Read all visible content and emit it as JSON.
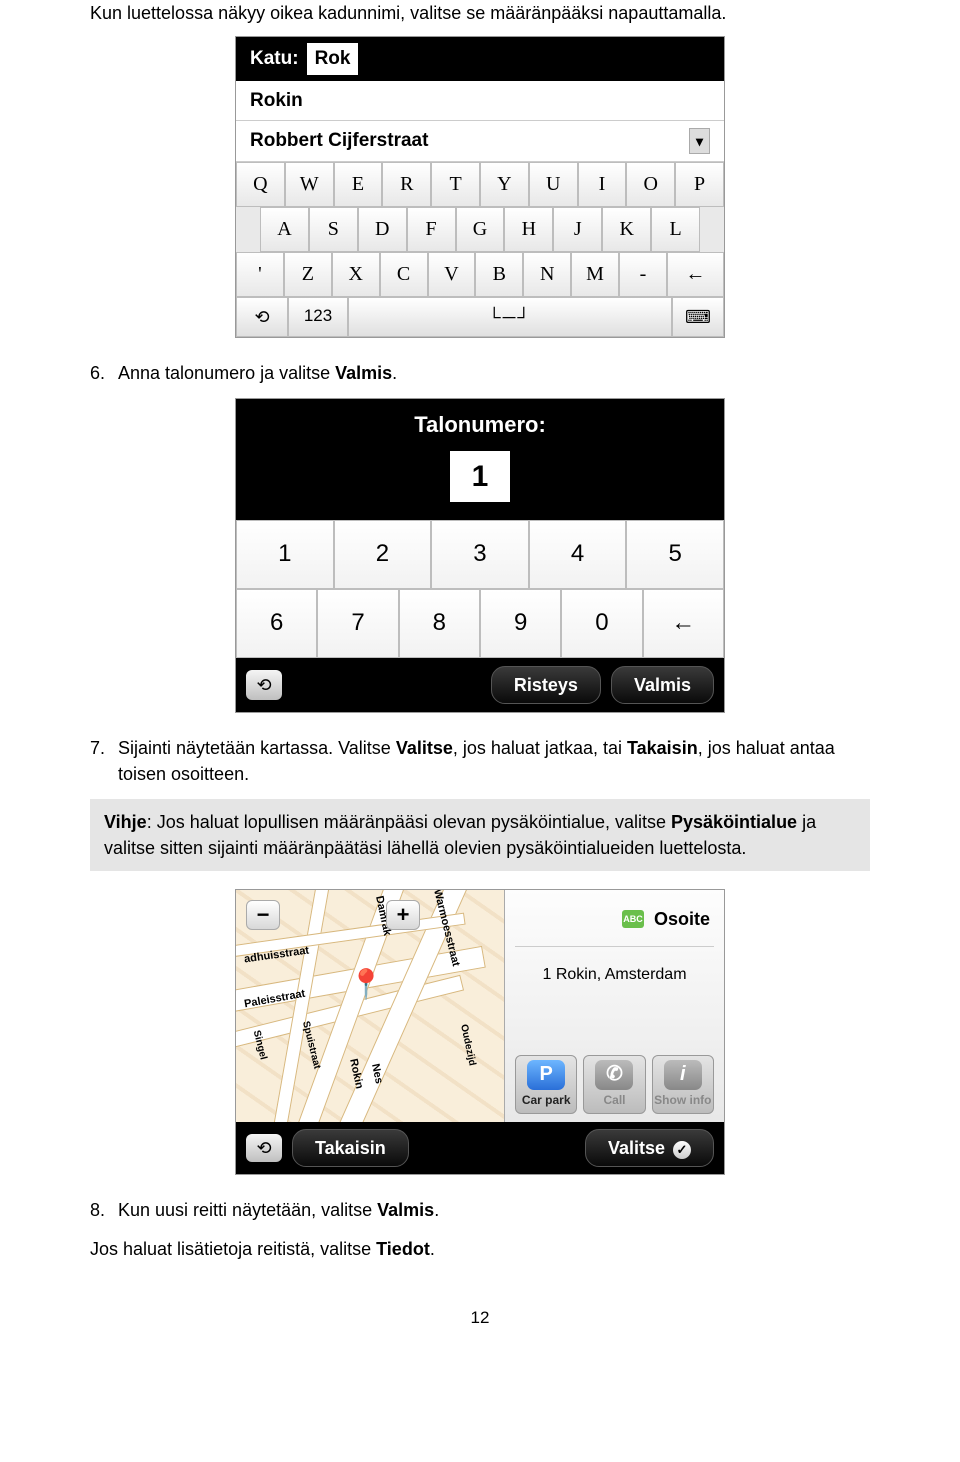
{
  "intro_para": "Kun luettelossa näkyy oikea kadunnimi, valitse se määränpääksi napauttamalla.",
  "shot1": {
    "field_label": "Katu:",
    "field_value": "Rok",
    "suggestions": [
      "Rokin",
      "Robbert Cijferstraat"
    ],
    "dropdown_glyph": "▾",
    "kbd_row1": [
      "Q",
      "W",
      "E",
      "R",
      "T",
      "Y",
      "U",
      "I",
      "O",
      "P"
    ],
    "kbd_row2": [
      "A",
      "S",
      "D",
      "F",
      "G",
      "H",
      "J",
      "K",
      "L"
    ],
    "kbd_row3": [
      "'",
      "Z",
      "X",
      "C",
      "V",
      "B",
      "N",
      "M",
      "-"
    ],
    "backspace": "←",
    "back_icon": "⟲",
    "mode_label": "123",
    "space_glyph": "└─┘",
    "kbd_icon": "⌨"
  },
  "step6": {
    "num": "6.",
    "text_before": "Anna talonumero ja valitse ",
    "bold": "Valmis",
    "text_after": "."
  },
  "shot2": {
    "field_label": "Talonumero:",
    "field_value": "1",
    "row1": [
      "1",
      "2",
      "3",
      "4",
      "5"
    ],
    "row2": [
      "6",
      "7",
      "8",
      "9",
      "0"
    ],
    "backspace": "←",
    "back_icon": "⟲",
    "btn_left": "Risteys",
    "btn_right": "Valmis"
  },
  "step7": {
    "num": "7.",
    "p1_a": "Sijainti näytetään kartassa. Valitse ",
    "p1_b1": "Valitse",
    "p1_c": ", jos haluat jatkaa, tai ",
    "p1_b2": "Takaisin",
    "p1_d": ", jos haluat antaa toisen osoitteen."
  },
  "hint": {
    "label": "Vihje",
    "a": ": Jos haluat lopullisen määränpääsi olevan pysäköintialue, valitse ",
    "b": "Pysäköintialue",
    "c": " ja valitse sitten sijainti määränpäätäsi lähellä olevien pysäköintialueiden luettelosta."
  },
  "shot3": {
    "zoom_minus": "−",
    "zoom_plus": "+",
    "abc": "ABC",
    "panel_title": "Osoite",
    "address_line": "1 Rokin, Amsterdam",
    "tile_park": "Car park",
    "tile_call": "Call",
    "tile_info": "Show info",
    "park_glyph": "P",
    "call_glyph": "✆",
    "info_glyph": "i",
    "road_labels": [
      "adhuisstraat",
      "Paleisstraat",
      "Damrak",
      "Warmoesstraat",
      "Singel",
      "Spuistraat",
      "Rokin",
      "Nes",
      "Oudezijd"
    ],
    "back_icon": "⟲",
    "btn_left": "Takaisin",
    "btn_right": "Valitse",
    "check": "✓"
  },
  "step8": {
    "num": "8.",
    "a": "Kun uusi reitti näytetään, valitse ",
    "b": "Valmis",
    "c": "."
  },
  "closing": {
    "a": "Jos haluat lisätietoja reitistä, valitse ",
    "b": "Tiedot",
    "c": "."
  },
  "page_number": "12"
}
